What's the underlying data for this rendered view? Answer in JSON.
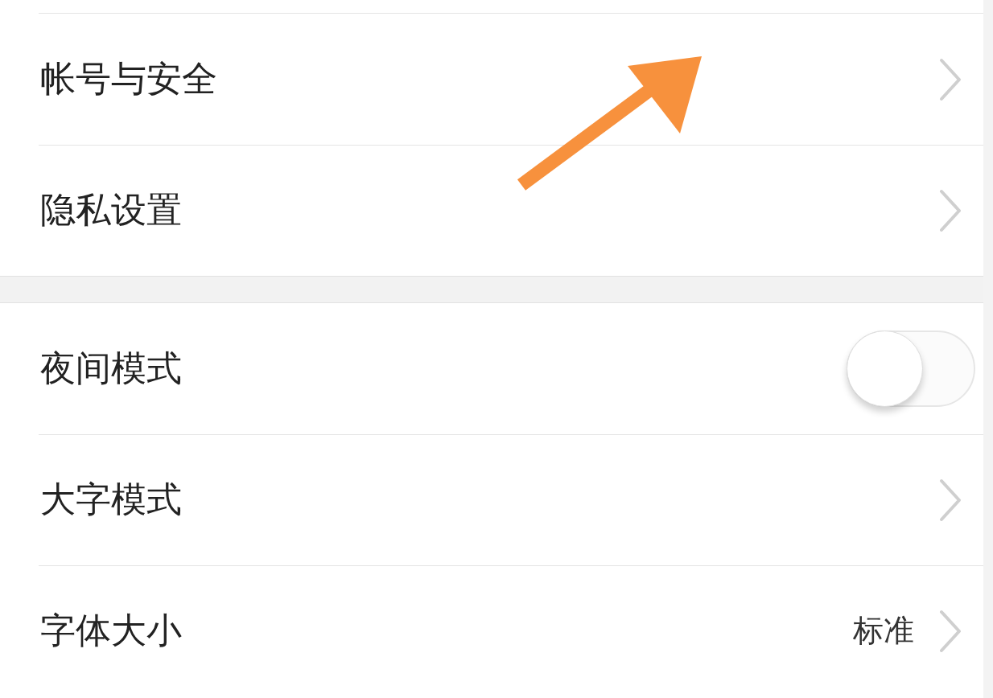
{
  "groups": [
    {
      "rows": [
        {
          "kind": "link",
          "label": "帐号与安全"
        },
        {
          "kind": "link",
          "label": "隐私设置"
        }
      ]
    },
    {
      "rows": [
        {
          "kind": "toggle",
          "label": "夜间模式",
          "on": false
        },
        {
          "kind": "link",
          "label": "大字模式"
        },
        {
          "kind": "link",
          "label": "字体大小",
          "value": "标准"
        }
      ]
    }
  ]
}
